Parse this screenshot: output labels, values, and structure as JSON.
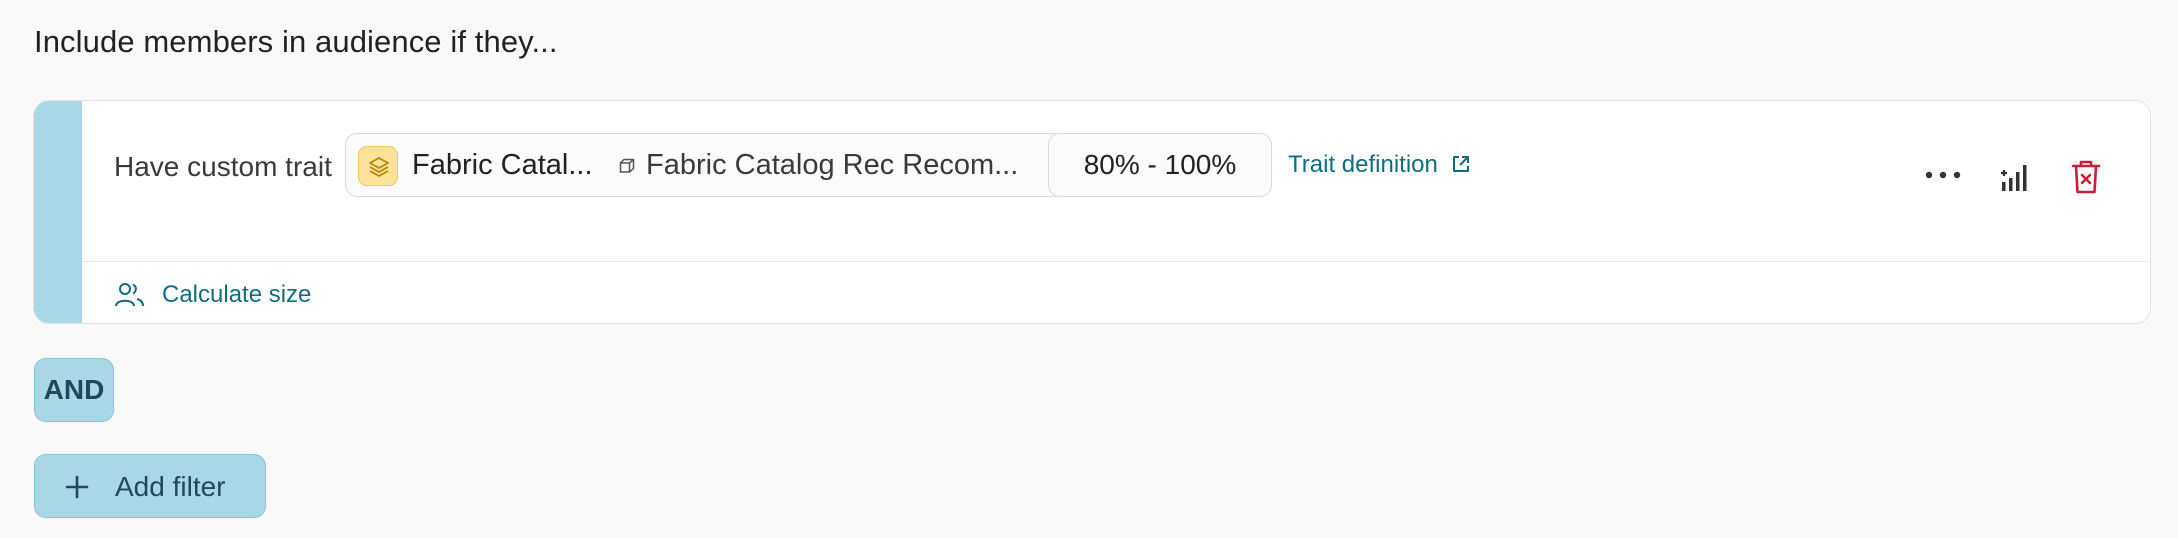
{
  "heading": "Include members in audience if they...",
  "condition": {
    "prefix": "Have custom trait",
    "trait_name": "Fabric Catal...",
    "trait_model": "Fabric Catalog Rec Recom...",
    "range": "80% - 100%",
    "definition_link": "Trait definition",
    "calculate_size": "Calculate size"
  },
  "operator": "AND",
  "add_filter_label": "Add filter",
  "icons": {
    "trait_badge": "layers-icon",
    "model": "cube-icon",
    "external": "external-link-icon",
    "more": "more-horizontal-icon",
    "stats": "signal-bars-icon",
    "delete": "trash-icon",
    "people": "users-icon",
    "add": "plus-icon"
  },
  "colors": {
    "accent": "#a8d8e6",
    "link": "#0e6e80",
    "delete": "#c8203a",
    "badge": "#fbe49a"
  }
}
